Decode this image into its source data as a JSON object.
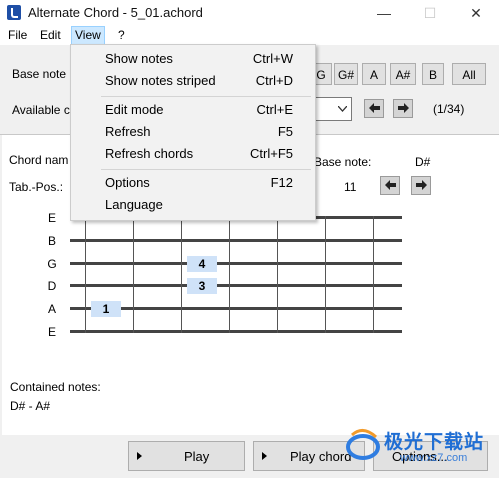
{
  "window": {
    "title": "Alternate Chord - 5_01.achord"
  },
  "menubar": [
    "File",
    "Edit",
    "View",
    "?"
  ],
  "toolbar": {
    "base_note_label": "Base note",
    "note_buttons": [
      "G",
      "G#",
      "A",
      "A#",
      "B",
      "All"
    ],
    "available_label": "Available c",
    "position_counter": "(1/34)"
  },
  "view_menu": {
    "items": [
      {
        "label": "Show notes",
        "shortcut": "Ctrl+W"
      },
      {
        "label": "Show notes striped",
        "shortcut": "Ctrl+D"
      },
      {
        "label": "Edit mode",
        "shortcut": "Ctrl+E"
      },
      {
        "label": "Refresh",
        "shortcut": "F5"
      },
      {
        "label": "Refresh chords",
        "shortcut": "Ctrl+F5"
      },
      {
        "label": "Options",
        "shortcut": "F12"
      },
      {
        "label": "Language",
        "shortcut": ""
      }
    ]
  },
  "chord_info": {
    "chord_name_label": "Chord nam",
    "tab_pos_label": "Tab.-Pos.:",
    "base_note_label": "Base note:",
    "base_note_value": "D#",
    "tab_pos_value": "11"
  },
  "fretboard": {
    "strings": [
      "E",
      "B",
      "G",
      "D",
      "A",
      "E"
    ],
    "fingers": [
      {
        "string": "G",
        "fret": 3,
        "label": "4"
      },
      {
        "string": "D",
        "fret": 3,
        "label": "3"
      },
      {
        "string": "A",
        "fret": 1,
        "label": "1"
      }
    ]
  },
  "contained": {
    "label": "Contained notes:",
    "value": "D# - A#"
  },
  "bottom": {
    "play_label": "Play",
    "play_chord_label": "Play chord",
    "options_label": "Options..."
  },
  "watermark": {
    "text": "极光下载站",
    "url_text": "www.xz7.com"
  },
  "colors": {
    "menu_highlight": "#cce8ff",
    "finger_fill": "#cfe2f8",
    "accent": "#1f4fa6"
  }
}
